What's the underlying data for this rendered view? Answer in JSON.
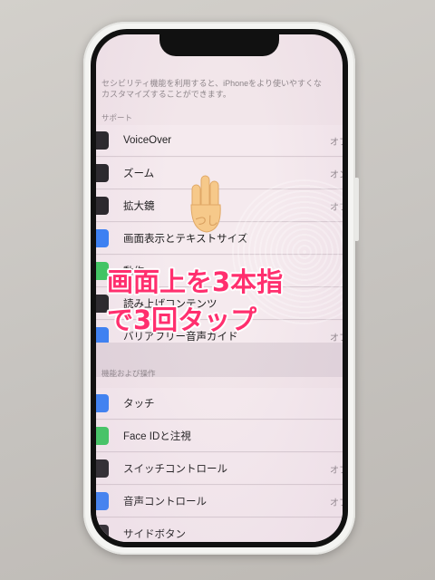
{
  "settings": {
    "description": "セシビリティ機能を利用すると、iPhoneをより使いやすくな\nカスタマイズすることができます。",
    "section_support": "サポート",
    "section_physical": "機能および操作",
    "rows_support": [
      {
        "label": "VoiceOver",
        "value": "オフ",
        "icon_color": "#1c1c1e"
      },
      {
        "label": "ズーム",
        "value": "オン",
        "icon_color": "#1c1c1e"
      },
      {
        "label": "拡大鏡",
        "value": "オフ",
        "icon_color": "#1c1c1e"
      },
      {
        "label": "画面表示とテキストサイズ",
        "value": "",
        "icon_color": "#2f7cf6"
      },
      {
        "label": "動作",
        "value": "",
        "icon_color": "#34c759"
      },
      {
        "label": "読み上げコンテンツ",
        "value": "",
        "icon_color": "#1c1c1e"
      },
      {
        "label": "バリアフリー音声ガイド",
        "value": "オフ",
        "icon_color": "#2f7cf6"
      }
    ],
    "rows_physical": [
      {
        "label": "タッチ",
        "value": "",
        "icon_color": "#2f7cf6"
      },
      {
        "label": "Face IDと注視",
        "value": "",
        "icon_color": "#34c759"
      },
      {
        "label": "スイッチコントロール",
        "value": "オフ",
        "icon_color": "#1c1c1e"
      },
      {
        "label": "音声コントロール",
        "value": "オフ",
        "icon_color": "#2f7cf6"
      },
      {
        "label": "サイドボタン",
        "value": "",
        "icon_color": "#1c1c1e"
      }
    ]
  },
  "annotation": {
    "line1": "画面上を3本指",
    "line2": "で3回タップ",
    "hand_note": "つし"
  },
  "colors": {
    "overlay_text": "#ff2f6e",
    "screen_bg": "#f2e6ea"
  }
}
